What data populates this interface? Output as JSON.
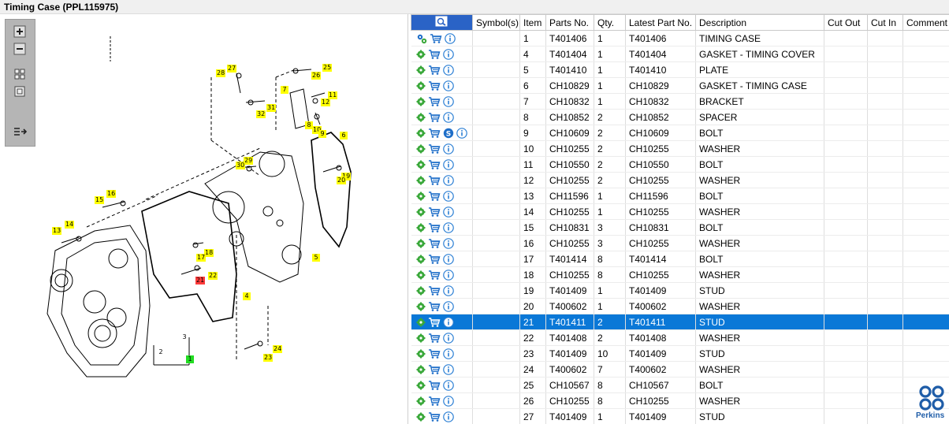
{
  "window": {
    "title": "Timing Case (PPL115975)"
  },
  "toolbar": {
    "icons": [
      "zoom-in-icon",
      "zoom-out-icon",
      "fit-grid-icon",
      "actual-size-icon",
      "toggle-list-icon"
    ]
  },
  "diagram": {
    "callouts": [
      {
        "label": "27"
      },
      {
        "label": "28"
      },
      {
        "label": "25"
      },
      {
        "label": "26"
      },
      {
        "label": "7"
      },
      {
        "label": "11"
      },
      {
        "label": "12"
      },
      {
        "label": "31"
      },
      {
        "label": "32"
      },
      {
        "label": "8"
      },
      {
        "label": "10"
      },
      {
        "label": "9"
      },
      {
        "label": "6"
      },
      {
        "label": "29"
      },
      {
        "label": "30"
      },
      {
        "label": "19"
      },
      {
        "label": "20"
      },
      {
        "label": "16"
      },
      {
        "label": "15"
      },
      {
        "label": "14"
      },
      {
        "label": "13"
      },
      {
        "label": "18"
      },
      {
        "label": "17"
      },
      {
        "label": "5"
      },
      {
        "label": "22"
      },
      {
        "label": "21"
      },
      {
        "label": "4"
      },
      {
        "label": "3"
      },
      {
        "label": "2"
      },
      {
        "label": "1"
      },
      {
        "label": "24"
      },
      {
        "label": "23"
      }
    ],
    "selected_callout": "21"
  },
  "table": {
    "columns": [
      "Symbol(s)",
      "Item",
      "Parts No.",
      "Qty.",
      "Latest Part No.",
      "Description",
      "Cut Out",
      "Cut In",
      "Comment"
    ],
    "header_icon": "parts-search-icon",
    "selected_item": "21",
    "rows": [
      {
        "item": "1",
        "part": "T401406",
        "qty": "1",
        "latest": "T401406",
        "desc": "TIMING CASE",
        "icons": [
          "assembly-gears-icon",
          "cart-icon",
          "info-icon"
        ]
      },
      {
        "item": "4",
        "part": "T401404",
        "qty": "1",
        "latest": "T401404",
        "desc": "GASKET - TIMING COVER",
        "icons": [
          "gear-icon",
          "cart-icon",
          "info-icon"
        ]
      },
      {
        "item": "5",
        "part": "T401410",
        "qty": "1",
        "latest": "T401410",
        "desc": "PLATE",
        "icons": [
          "gear-icon",
          "cart-icon",
          "info-icon"
        ]
      },
      {
        "item": "6",
        "part": "CH10829",
        "qty": "1",
        "latest": "CH10829",
        "desc": "GASKET - TIMING CASE",
        "icons": [
          "gear-icon",
          "cart-icon",
          "info-icon"
        ]
      },
      {
        "item": "7",
        "part": "CH10832",
        "qty": "1",
        "latest": "CH10832",
        "desc": "BRACKET",
        "icons": [
          "gear-icon",
          "cart-icon",
          "info-icon"
        ]
      },
      {
        "item": "8",
        "part": "CH10852",
        "qty": "2",
        "latest": "CH10852",
        "desc": "SPACER",
        "icons": [
          "gear-icon",
          "cart-icon",
          "info-icon"
        ]
      },
      {
        "item": "9",
        "part": "CH10609",
        "qty": "2",
        "latest": "CH10609",
        "desc": "BOLT",
        "icons": [
          "gear-icon",
          "cart-icon",
          "supersession-icon",
          "info-icon"
        ]
      },
      {
        "item": "10",
        "part": "CH10255",
        "qty": "2",
        "latest": "CH10255",
        "desc": "WASHER",
        "icons": [
          "gear-icon",
          "cart-icon",
          "info-icon"
        ]
      },
      {
        "item": "11",
        "part": "CH10550",
        "qty": "2",
        "latest": "CH10550",
        "desc": "BOLT",
        "icons": [
          "gear-icon",
          "cart-icon",
          "info-icon"
        ]
      },
      {
        "item": "12",
        "part": "CH10255",
        "qty": "2",
        "latest": "CH10255",
        "desc": "WASHER",
        "icons": [
          "gear-icon",
          "cart-icon",
          "info-icon"
        ]
      },
      {
        "item": "13",
        "part": "CH11596",
        "qty": "1",
        "latest": "CH11596",
        "desc": "BOLT",
        "icons": [
          "gear-icon",
          "cart-icon",
          "info-icon"
        ]
      },
      {
        "item": "14",
        "part": "CH10255",
        "qty": "1",
        "latest": "CH10255",
        "desc": "WASHER",
        "icons": [
          "gear-icon",
          "cart-icon",
          "info-icon"
        ]
      },
      {
        "item": "15",
        "part": "CH10831",
        "qty": "3",
        "latest": "CH10831",
        "desc": "BOLT",
        "icons": [
          "gear-icon",
          "cart-icon",
          "info-icon"
        ]
      },
      {
        "item": "16",
        "part": "CH10255",
        "qty": "3",
        "latest": "CH10255",
        "desc": "WASHER",
        "icons": [
          "gear-icon",
          "cart-icon",
          "info-icon"
        ]
      },
      {
        "item": "17",
        "part": "T401414",
        "qty": "8",
        "latest": "T401414",
        "desc": "BOLT",
        "icons": [
          "gear-icon",
          "cart-icon",
          "info-icon"
        ]
      },
      {
        "item": "18",
        "part": "CH10255",
        "qty": "8",
        "latest": "CH10255",
        "desc": "WASHER",
        "icons": [
          "gear-icon",
          "cart-icon",
          "info-icon"
        ]
      },
      {
        "item": "19",
        "part": "T401409",
        "qty": "1",
        "latest": "T401409",
        "desc": "STUD",
        "icons": [
          "gear-icon",
          "cart-icon",
          "info-icon"
        ]
      },
      {
        "item": "20",
        "part": "T400602",
        "qty": "1",
        "latest": "T400602",
        "desc": "WASHER",
        "icons": [
          "gear-icon",
          "cart-icon",
          "info-icon"
        ]
      },
      {
        "item": "21",
        "part": "T401411",
        "qty": "2",
        "latest": "T401411",
        "desc": "STUD",
        "icons": [
          "gear-icon",
          "cart-icon",
          "info-icon"
        ]
      },
      {
        "item": "22",
        "part": "T401408",
        "qty": "2",
        "latest": "T401408",
        "desc": "WASHER",
        "icons": [
          "gear-icon",
          "cart-icon",
          "info-icon"
        ]
      },
      {
        "item": "23",
        "part": "T401409",
        "qty": "10",
        "latest": "T401409",
        "desc": "STUD",
        "icons": [
          "gear-icon",
          "cart-icon",
          "info-icon"
        ]
      },
      {
        "item": "24",
        "part": "T400602",
        "qty": "7",
        "latest": "T400602",
        "desc": "WASHER",
        "icons": [
          "gear-icon",
          "cart-icon",
          "info-icon"
        ]
      },
      {
        "item": "25",
        "part": "CH10567",
        "qty": "8",
        "latest": "CH10567",
        "desc": "BOLT",
        "icons": [
          "gear-icon",
          "cart-icon",
          "info-icon"
        ]
      },
      {
        "item": "26",
        "part": "CH10255",
        "qty": "8",
        "latest": "CH10255",
        "desc": "WASHER",
        "icons": [
          "gear-icon",
          "cart-icon",
          "info-icon"
        ]
      },
      {
        "item": "27",
        "part": "T401409",
        "qty": "1",
        "latest": "T401409",
        "desc": "STUD",
        "icons": [
          "gear-icon",
          "cart-icon",
          "info-icon"
        ]
      }
    ]
  },
  "brand": {
    "name": "Perkins",
    "icon": "perkins-logo-icon"
  },
  "colors": {
    "selected_row": "#0a78d7",
    "callout": "#ffff00",
    "callout_selected": "#ff3b3b",
    "callout_main": "#22dd22",
    "gear": "#3aa83a",
    "cart": "#1e6ec8",
    "info": "#2b7fd4"
  }
}
